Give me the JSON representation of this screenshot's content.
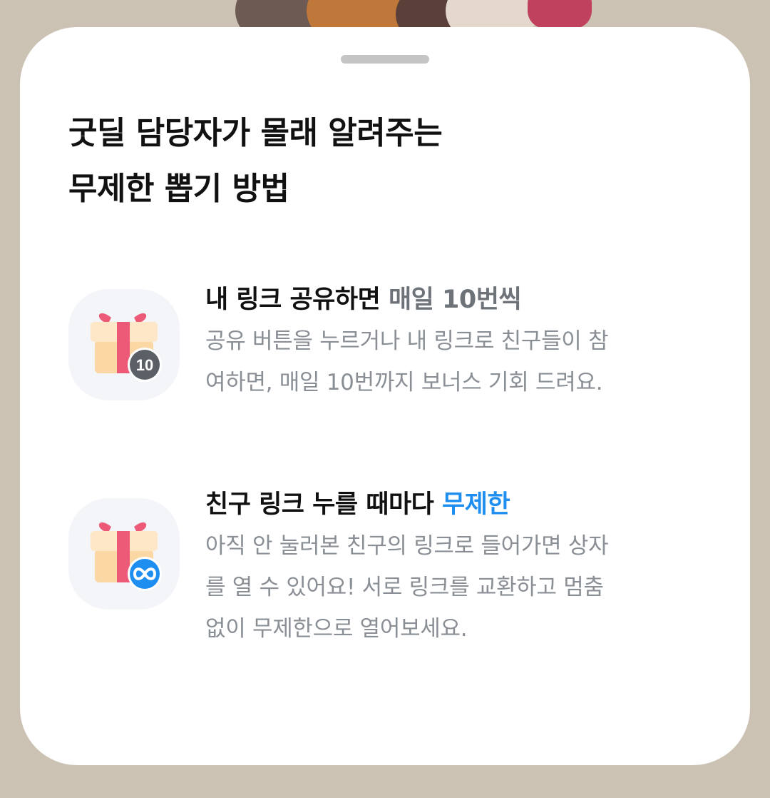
{
  "sheet": {
    "title_lines": [
      "굿딜 담당자가 몰래 알려주는",
      "무제한 뽑기 방법"
    ]
  },
  "features": [
    {
      "title_main": "내 링크 공유하면 ",
      "title_highlight": "매일 10번씩",
      "highlight_color": "#6e7379",
      "badge_text": "10",
      "description_lines": [
        "공유 버튼을 누르거나 내 링크로 친구들이 참",
        "여하면, 매일 10번까지 보너스 기회 드려요."
      ]
    },
    {
      "title_main": "친구 링크 누를 때마다 ",
      "title_highlight": "무제한",
      "highlight_color": "#1e8ff0",
      "badge_icon": "infinity-icon",
      "description_lines": [
        "아직 안 눌러본 친구의 링크로 들어가면 상자",
        "를 열 수 있어요! 서로 링크를 교환하고 멈춤",
        "없이 무제한으로 열어보세요."
      ]
    }
  ],
  "colors": {
    "backdrop": "#ccc2b4",
    "sheet": "#ffffff",
    "gift_box": "#fbd7a4",
    "gift_ribbon": "#ec5a78",
    "badge_gray": "#5b5f66",
    "badge_blue": "#1e8ff0"
  }
}
